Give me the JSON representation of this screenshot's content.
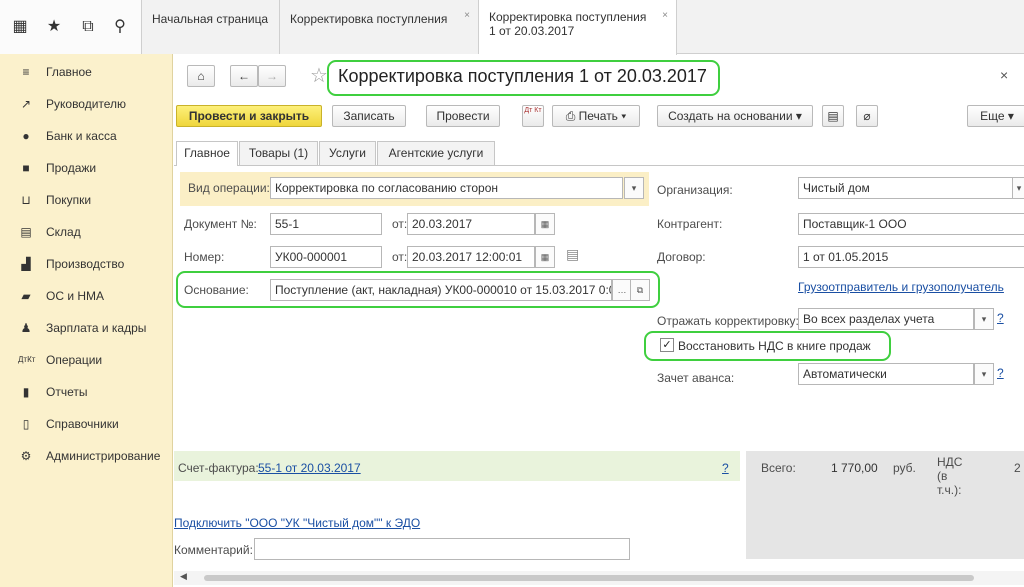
{
  "topbar": {
    "tabs": [
      {
        "label": "Начальная страница"
      },
      {
        "label": "Корректировка поступления"
      },
      {
        "label_line1": "Корректировка поступления",
        "label_line2": "1 от 20.03.2017"
      }
    ],
    "close_glyph": "×"
  },
  "sidebar": {
    "items": [
      {
        "label": "Главное",
        "icon": "menu-icon"
      },
      {
        "label": "Руководителю",
        "icon": "chart-line-icon"
      },
      {
        "label": "Банк и касса",
        "icon": "coin-icon"
      },
      {
        "label": "Продажи",
        "icon": "shopping-bag-icon"
      },
      {
        "label": "Покупки",
        "icon": "cart-icon"
      },
      {
        "label": "Склад",
        "icon": "warehouse-icon"
      },
      {
        "label": "Производство",
        "icon": "factory-icon"
      },
      {
        "label": "ОС и НМА",
        "icon": "truck-icon"
      },
      {
        "label": "Зарплата и кадры",
        "icon": "person-icon"
      },
      {
        "label": "Операции",
        "icon": "dt-kt-icon"
      },
      {
        "label": "Отчеты",
        "icon": "bar-chart-icon"
      },
      {
        "label": "Справочники",
        "icon": "book-icon"
      },
      {
        "label": "Администрирование",
        "icon": "gear-icon"
      }
    ]
  },
  "form": {
    "title": "Корректировка поступления 1 от 20.03.2017",
    "close": "×",
    "toolbar": {
      "post_close": "Провести и закрыть",
      "save": "Записать",
      "post": "Провести",
      "dtkt": "Дт Кт",
      "print": "Печать",
      "create_based": "Создать на основании",
      "more": "Еще"
    },
    "tabs": [
      "Главное",
      "Товары (1)",
      "Услуги",
      "Агентские услуги"
    ],
    "fields": {
      "op_type_label": "Вид операции:",
      "op_type_value": "Корректировка по согласованию сторон",
      "doc_no_label": "Документ №:",
      "doc_no_value": "55-1",
      "doc_date_label": "от:",
      "doc_date_value": "20.03.2017",
      "number_label": "Номер:",
      "number_value": "УК00-000001",
      "number_date_label": "от:",
      "number_date_value": "20.03.2017 12:00:01",
      "basis_label": "Основание:",
      "basis_value": "Поступление (акт, накладная) УК00-000010 от 15.03.2017 0:0",
      "org_label": "Организация:",
      "org_value": "Чистый дом",
      "counterparty_label": "Контрагент:",
      "counterparty_value": "Поставщик-1 ООО",
      "contract_label": "Договор:",
      "contract_value": "1 от 01.05.2015",
      "shipper_link": "Грузоотправитель и грузополучатель",
      "reflect_label": "Отражать корректировку:",
      "reflect_value": "Во всех разделах учета",
      "vat_restore_label": "Восстановить НДС в книге продаж",
      "vat_restore_checked": true,
      "advance_label": "Зачет аванса:",
      "advance_value": "Автоматически",
      "help": "?"
    },
    "footer": {
      "invoice_label": "Счет-фактура:",
      "invoice_link": "55-1 от 20.03.2017",
      "total_label": "Всего:",
      "total_value": "1 770,00",
      "currency": "руб.",
      "vat_label_1": "НДС",
      "vat_label_2": "(в",
      "vat_label_3": "т.ч.):",
      "vat_value": "2",
      "edo_link": "Подключить \"ООО \"УК \"Чистый дом\"\" к ЭДО",
      "comment_label": "Комментарий:",
      "comment_value": ""
    }
  },
  "colors": {
    "highlight": "#3fcf3f",
    "primary_button": "#f6e35a",
    "sidebar": "#fbf1cc",
    "link": "#1a4fa3"
  }
}
